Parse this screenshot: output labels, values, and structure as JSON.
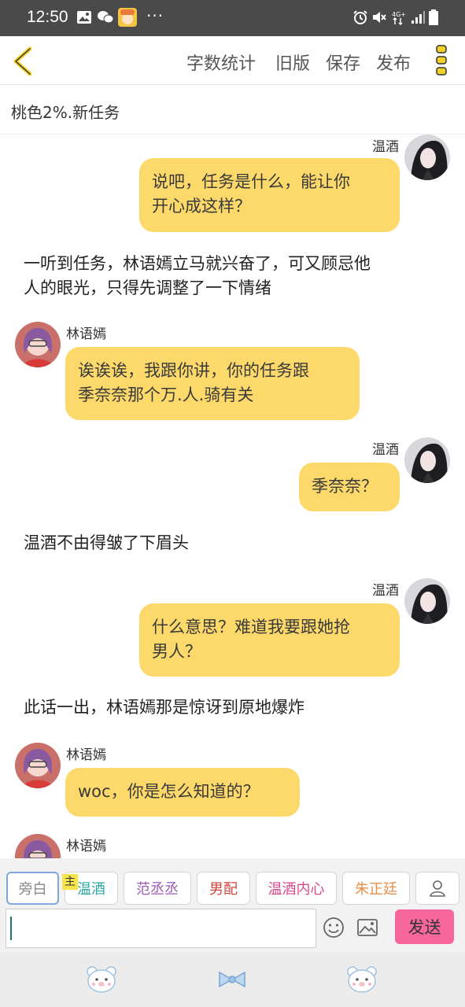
{
  "status_bar": {
    "time": "12:50",
    "dots": "···",
    "icons": [
      "gallery-icon",
      "wechat-icon",
      "app-avatar-icon",
      "alarm-icon",
      "mute-icon",
      "network-4g-icon",
      "signal-icon",
      "battery-icon"
    ],
    "network_label": "4G+"
  },
  "toolbar": {
    "back_icon": "chevron-left-icon",
    "word_count": "字数统计",
    "old_version": "旧版",
    "save": "保存",
    "publish": "发布",
    "more_icon": "more-vertical-icon"
  },
  "story_title": "桃色2%.新任务",
  "messages": [
    {
      "type": "chat",
      "side": "right",
      "name": "温酒",
      "lines": [
        "说吧，任务是什么，能让你",
        "开心成这样？"
      ]
    },
    {
      "type": "narration",
      "lines": [
        "一听到任务，林语嫣立马就兴奋了，可又顾忌他",
        "人的眼光，只得先调整了一下情绪"
      ]
    },
    {
      "type": "chat",
      "side": "left",
      "name": "林语嫣",
      "lines": [
        "诶诶诶，我跟你讲，你的任务跟",
        "季奈奈那个万.人.骑有关"
      ]
    },
    {
      "type": "chat",
      "side": "right",
      "name": "温酒",
      "lines": [
        "季奈奈？"
      ]
    },
    {
      "type": "narration",
      "lines": [
        "温酒不由得皱了下眉头"
      ]
    },
    {
      "type": "chat",
      "side": "right",
      "name": "温酒",
      "lines": [
        "什么意思？难道我要跟她抢",
        "男人？"
      ]
    },
    {
      "type": "narration",
      "lines": [
        "此话一出，林语嫣那是惊讶到原地爆炸"
      ]
    },
    {
      "type": "chat",
      "side": "left",
      "name": "林语嫣",
      "lines": [
        "woc，你是怎么知道的？"
      ]
    },
    {
      "type": "chat",
      "side": "left",
      "name": "林语嫣",
      "lines": []
    }
  ],
  "roles": [
    {
      "label": "旁白",
      "color": "#888888",
      "selected": true
    },
    {
      "label": "温酒",
      "color": "#2aa7a0",
      "selected": false,
      "badge": "主"
    },
    {
      "label": "范丞丞",
      "color": "#9b59b6",
      "selected": false
    },
    {
      "label": "男配",
      "color": "#d0453a",
      "selected": false
    },
    {
      "label": "温酒内心",
      "color": "#d94a8c",
      "selected": false
    },
    {
      "label": "朱正廷",
      "color": "#e8904a",
      "selected": false
    }
  ],
  "role_add_icon": "person-icon",
  "composer": {
    "value": "",
    "emoji_icon": "emoji-icon",
    "image_icon": "image-icon",
    "send_label": "发送"
  },
  "bottom_nav": [
    "bear-icon",
    "bow-icon",
    "bear-icon"
  ],
  "colors": {
    "bubble": "#fcd96a",
    "send": "#f7679b",
    "status_bar": "#4a4a4a"
  }
}
